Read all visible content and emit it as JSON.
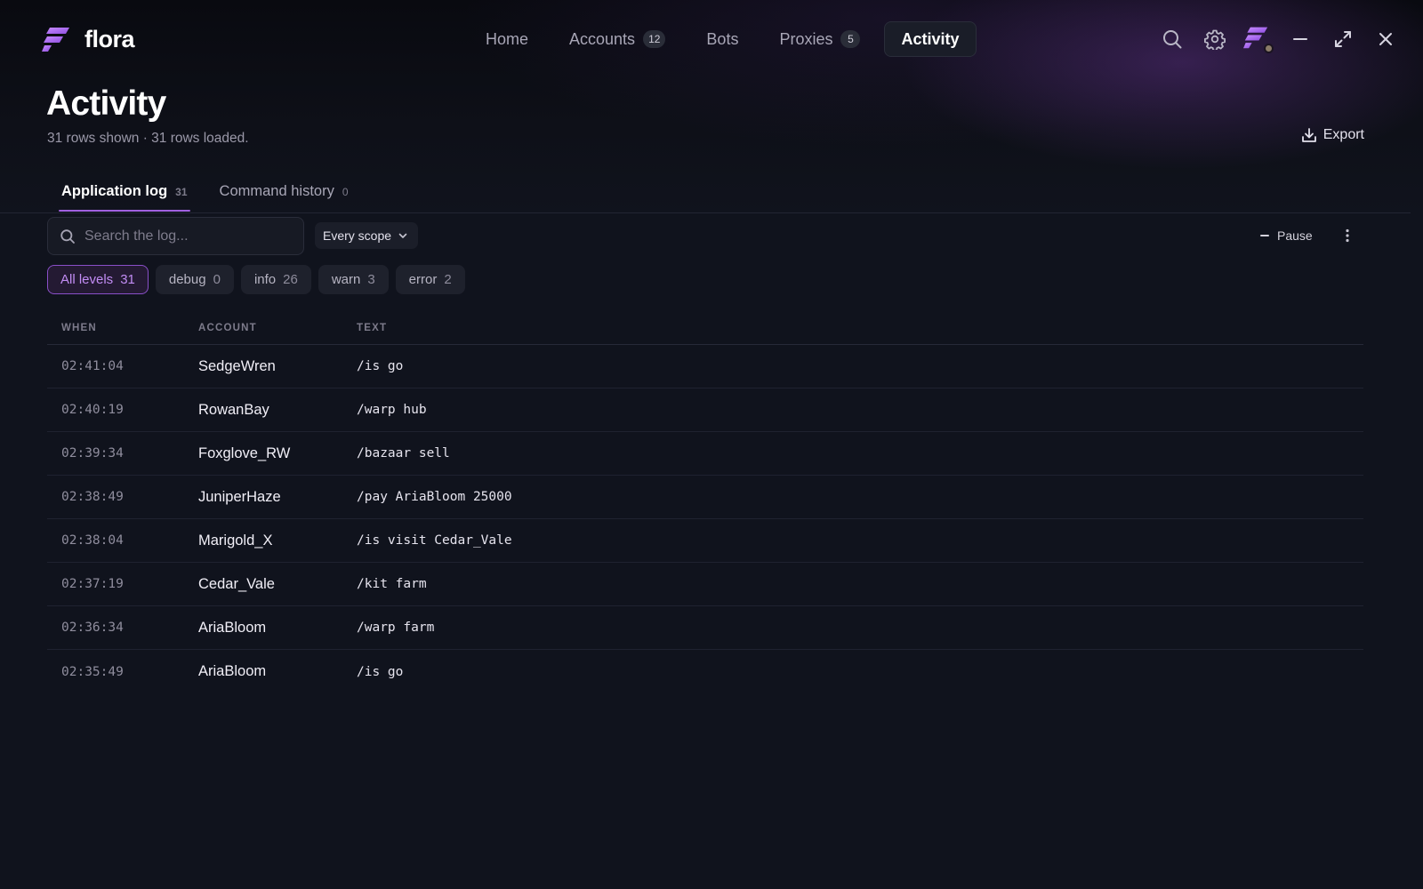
{
  "app": {
    "name": "flora"
  },
  "nav": {
    "items": [
      {
        "label": "Home",
        "badge": null,
        "active": false
      },
      {
        "label": "Accounts",
        "badge": "12",
        "active": false
      },
      {
        "label": "Bots",
        "badge": null,
        "active": false
      },
      {
        "label": "Proxies",
        "badge": "5",
        "active": false
      },
      {
        "label": "Activity",
        "badge": null,
        "active": true
      }
    ]
  },
  "page": {
    "title": "Activity",
    "subtitle": "31 rows shown · 31 rows loaded.",
    "export_label": "Export"
  },
  "tabs": [
    {
      "label": "Application log",
      "count": "31",
      "active": true
    },
    {
      "label": "Command history",
      "count": "0",
      "active": false
    }
  ],
  "toolbar": {
    "search_placeholder": "Search the log...",
    "search_value": "",
    "scope_label": "Every scope",
    "pause_label": "Pause"
  },
  "levels": [
    {
      "label": "All levels",
      "count": "31",
      "active": true
    },
    {
      "label": "debug",
      "count": "0",
      "active": false
    },
    {
      "label": "info",
      "count": "26",
      "active": false
    },
    {
      "label": "warn",
      "count": "3",
      "active": false
    },
    {
      "label": "error",
      "count": "2",
      "active": false
    }
  ],
  "table": {
    "headers": {
      "when": "WHEN",
      "account": "ACCOUNT",
      "text": "TEXT"
    },
    "rows": [
      {
        "when": "02:41:04",
        "account": "SedgeWren",
        "text": "/is go"
      },
      {
        "when": "02:40:19",
        "account": "RowanBay",
        "text": "/warp hub"
      },
      {
        "when": "02:39:34",
        "account": "Foxglove_RW",
        "text": "/bazaar sell"
      },
      {
        "when": "02:38:49",
        "account": "JuniperHaze",
        "text": "/pay AriaBloom 25000"
      },
      {
        "when": "02:38:04",
        "account": "Marigold_X",
        "text": "/is visit Cedar_Vale"
      },
      {
        "when": "02:37:19",
        "account": "Cedar_Vale",
        "text": "/kit farm"
      },
      {
        "when": "02:36:34",
        "account": "AriaBloom",
        "text": "/warp farm"
      },
      {
        "when": "02:35:49",
        "account": "AriaBloom",
        "text": "/is go"
      }
    ]
  },
  "colors": {
    "accent": "#a160e0",
    "background": "#10131d",
    "status_dot": "#8a7b68"
  },
  "icons": {
    "logo": "flora-logo-icon",
    "search": "search-icon",
    "settings": "gear-icon",
    "minimize": "minimize-icon",
    "maximize": "maximize-icon",
    "close": "close-icon",
    "export": "download-icon",
    "scope": "chevron-down-icon",
    "more": "more-vertical-icon"
  }
}
